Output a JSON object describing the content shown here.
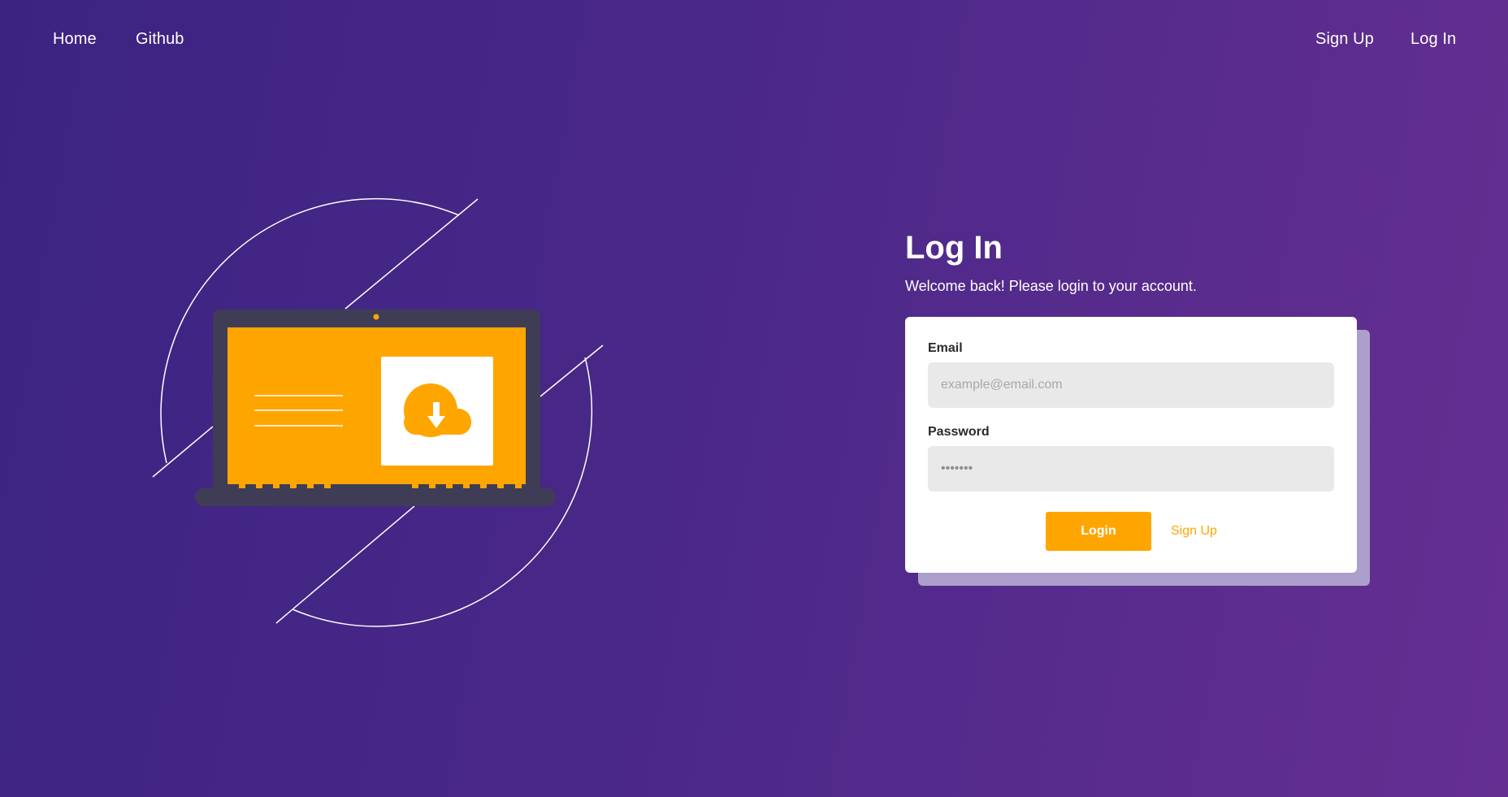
{
  "nav": {
    "home": "Home",
    "github": "Github",
    "signup": "Sign Up",
    "login": "Log In"
  },
  "login": {
    "title": "Log In",
    "subtitle": "Welcome back! Please login to your account.",
    "email_label": "Email",
    "email_placeholder": "example@email.com",
    "password_label": "Password",
    "password_value": "•••••••",
    "login_button": "Login",
    "signup_link": "Sign Up"
  },
  "colors": {
    "accent": "#ffa500",
    "background_start": "#3c2382",
    "background_end": "#652f92",
    "laptop": "#3f3d56"
  },
  "icons": [
    "laptop-illustration",
    "cloud-download-icon"
  ]
}
